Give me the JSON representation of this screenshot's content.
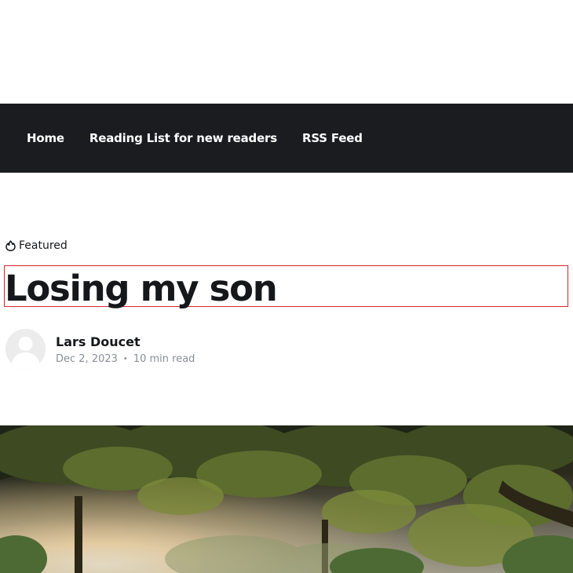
{
  "nav": {
    "items": [
      {
        "label": "Home"
      },
      {
        "label": "Reading List for new readers"
      },
      {
        "label": "RSS Feed"
      }
    ]
  },
  "article": {
    "featured_label": "Featured",
    "title": "Losing my son",
    "author": "Lars Doucet",
    "date": "Dec 2, 2023",
    "read_time": "10 min read"
  },
  "icons": {
    "featured": "flame-icon",
    "avatar": "user-avatar-placeholder"
  },
  "colors": {
    "nav_bg": "#1b1c20",
    "title_text": "#15171a",
    "meta_text": "#8a8f96",
    "highlight_border": "#d7262f"
  }
}
